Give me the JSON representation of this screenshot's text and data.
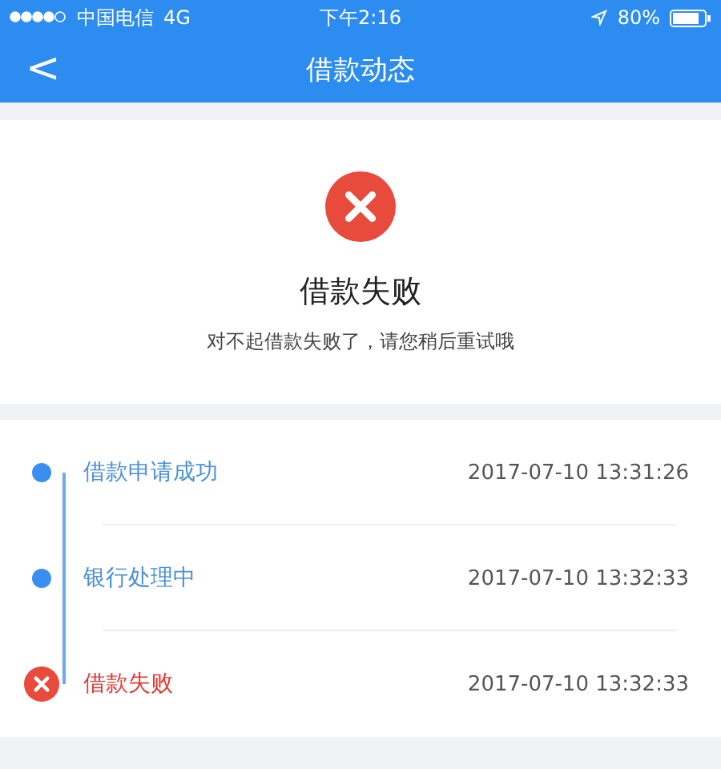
{
  "status_bar": {
    "carrier": "中国电信",
    "network": "4G",
    "time": "下午2:16",
    "battery": "80%"
  },
  "nav": {
    "back": "<",
    "title": "借款动态"
  },
  "result": {
    "kind": "failed",
    "title": "借款失败",
    "message": "对不起借款失败了，请您稍后重试哦"
  },
  "timeline": [
    {
      "kind": "done",
      "label": "借款申请成功",
      "time": "2017-07-10 13:31:26"
    },
    {
      "kind": "done",
      "label": "银行处理中",
      "time": "2017-07-10 13:32:33"
    },
    {
      "kind": "failed",
      "label": "借款失败",
      "time": "2017-07-10 13:32:33"
    }
  ]
}
